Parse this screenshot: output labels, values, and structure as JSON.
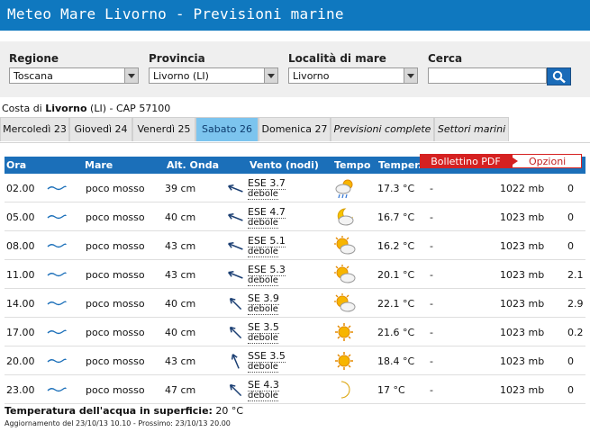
{
  "header": {
    "title": "Meteo Mare Livorno - Previsioni marine"
  },
  "filters": {
    "regione": {
      "label": "Regione",
      "value": "Toscana"
    },
    "provincia": {
      "label": "Provincia",
      "value": "Livorno (LI)"
    },
    "localita": {
      "label": "Località di mare",
      "value": "Livorno"
    },
    "cerca": {
      "label": "Cerca",
      "value": ""
    }
  },
  "location": {
    "prefix": "Costa di ",
    "name": "Livorno",
    "suffix": " (LI) - CAP 57100"
  },
  "tabs": [
    {
      "label": "Mercoledì 23",
      "active": false,
      "italic": false
    },
    {
      "label": "Giovedì 24",
      "active": false,
      "italic": false
    },
    {
      "label": "Venerdì 25",
      "active": false,
      "italic": false
    },
    {
      "label": "Sabato 26",
      "active": true,
      "italic": false
    },
    {
      "label": "Domenica 27",
      "active": false,
      "italic": false
    },
    {
      "label": "Previsioni complete",
      "active": false,
      "italic": true
    },
    {
      "label": "Settori marini",
      "active": false,
      "italic": true
    }
  ],
  "table": {
    "headers": {
      "ora": "Ora",
      "mare": "Mare",
      "onda": "Alt. Onda",
      "vento": "Vento (nodi)",
      "tempo": "Tempo",
      "temp": "Temper."
    },
    "rows": [
      {
        "ora": "02.00",
        "mare": "poco mosso",
        "onda": "39 cm",
        "dir": "ESE 3.7",
        "str": "debole",
        "wind_deg": 112,
        "wx": "sun-cloud-rain",
        "temp": "17.3 °C",
        "dash": "-",
        "press": "1022 mb",
        "rain": "0"
      },
      {
        "ora": "05.00",
        "mare": "poco mosso",
        "onda": "40 cm",
        "dir": "ESE 4.7",
        "str": "debole",
        "wind_deg": 112,
        "wx": "moon-cloud",
        "temp": "16.7 °C",
        "dash": "-",
        "press": "1023 mb",
        "rain": "0"
      },
      {
        "ora": "08.00",
        "mare": "poco mosso",
        "onda": "43 cm",
        "dir": "ESE 5.1",
        "str": "debole",
        "wind_deg": 112,
        "wx": "sun-cloud",
        "temp": "16.2 °C",
        "dash": "-",
        "press": "1023 mb",
        "rain": "0"
      },
      {
        "ora": "11.00",
        "mare": "poco mosso",
        "onda": "43 cm",
        "dir": "ESE 5.3",
        "str": "debole",
        "wind_deg": 112,
        "wx": "sun-cloud",
        "temp": "20.1 °C",
        "dash": "-",
        "press": "1023 mb",
        "rain": "2.1"
      },
      {
        "ora": "14.00",
        "mare": "poco mosso",
        "onda": "40 cm",
        "dir": "SE 3.9",
        "str": "debole",
        "wind_deg": 135,
        "wx": "sun-cloud",
        "temp": "22.1 °C",
        "dash": "-",
        "press": "1023 mb",
        "rain": "2.9"
      },
      {
        "ora": "17.00",
        "mare": "poco mosso",
        "onda": "40 cm",
        "dir": "SE 3.5",
        "str": "debole",
        "wind_deg": 135,
        "wx": "sun",
        "temp": "21.6 °C",
        "dash": "-",
        "press": "1023 mb",
        "rain": "0.2"
      },
      {
        "ora": "20.00",
        "mare": "poco mosso",
        "onda": "43 cm",
        "dir": "SSE 3.5",
        "str": "debole",
        "wind_deg": 157,
        "wx": "sun",
        "temp": "18.4 °C",
        "dash": "-",
        "press": "1023 mb",
        "rain": "0"
      },
      {
        "ora": "23.00",
        "mare": "poco mosso",
        "onda": "47 cm",
        "dir": "SE 4.3",
        "str": "debole",
        "wind_deg": 135,
        "wx": "moon",
        "temp": "17 °C",
        "dash": "-",
        "press": "1023 mb",
        "rain": "0"
      }
    ]
  },
  "menu": {
    "bollettino": "Bollettino PDF",
    "opzioni": "Opzioni"
  },
  "footer": {
    "sea_temp_label": "Temperatura dell'acqua in superficie:",
    "sea_temp_value": " 20 °C",
    "update": "Aggiornamento del 23/10/13 10.10 - Prossimo: 23/10/13 20.00"
  },
  "colors": {
    "brand": "#0f78bf",
    "header_row": "#1b6fb9",
    "active_tab": "#7cc4ee",
    "accent_red": "#d52121"
  }
}
